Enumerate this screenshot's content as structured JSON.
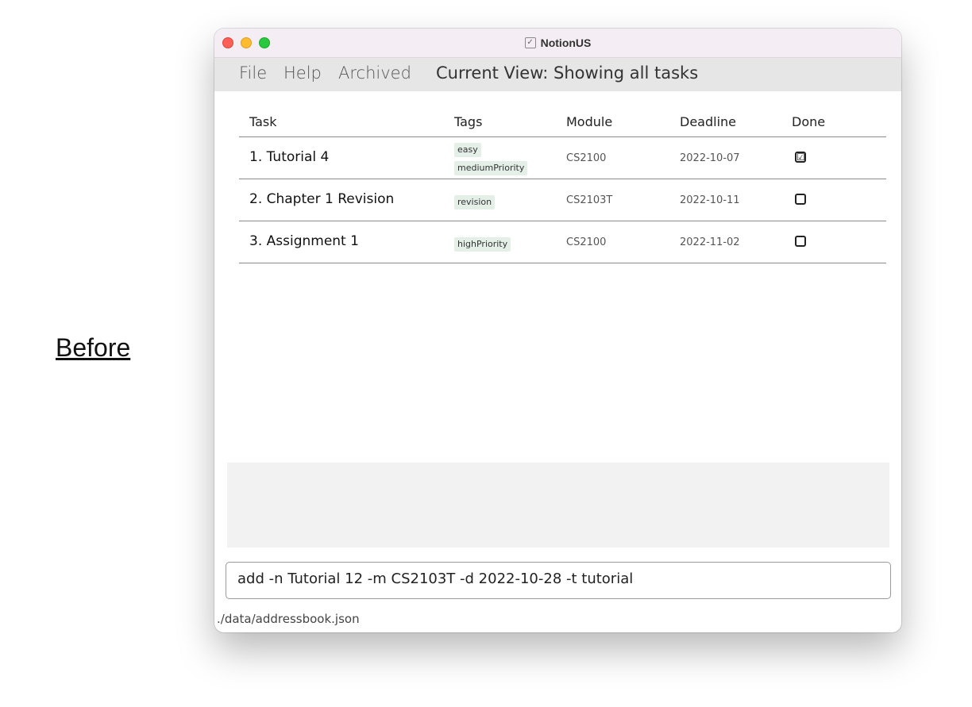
{
  "label": "Before",
  "window": {
    "title": "NotionUS",
    "title_icon": "checkbox-icon"
  },
  "menu": {
    "file": "File",
    "help": "Help",
    "archived": "Archived",
    "current_view": "Current View: Showing all tasks"
  },
  "table": {
    "headers": {
      "task": "Task",
      "tags": "Tags",
      "module": "Module",
      "deadline": "Deadline",
      "done": "Done"
    },
    "rows": [
      {
        "task": "1. Tutorial 4",
        "tags": [
          "easy",
          "mediumPriority"
        ],
        "module": "CS2100",
        "deadline": "2022-10-07",
        "done": "☑"
      },
      {
        "task": "2. Chapter 1 Revision",
        "tags": [
          "revision"
        ],
        "module": "CS2103T",
        "deadline": "2022-10-11",
        "done": ""
      },
      {
        "task": "3. Assignment 1",
        "tags": [
          "highPriority"
        ],
        "module": "CS2100",
        "deadline": "2022-11-02",
        "done": ""
      }
    ]
  },
  "result": "",
  "command": {
    "value": "add -n Tutorial 12 -m CS2103T -d 2022-10-28 -t tutorial"
  },
  "status": {
    "path": "./data/addressbook.json"
  }
}
